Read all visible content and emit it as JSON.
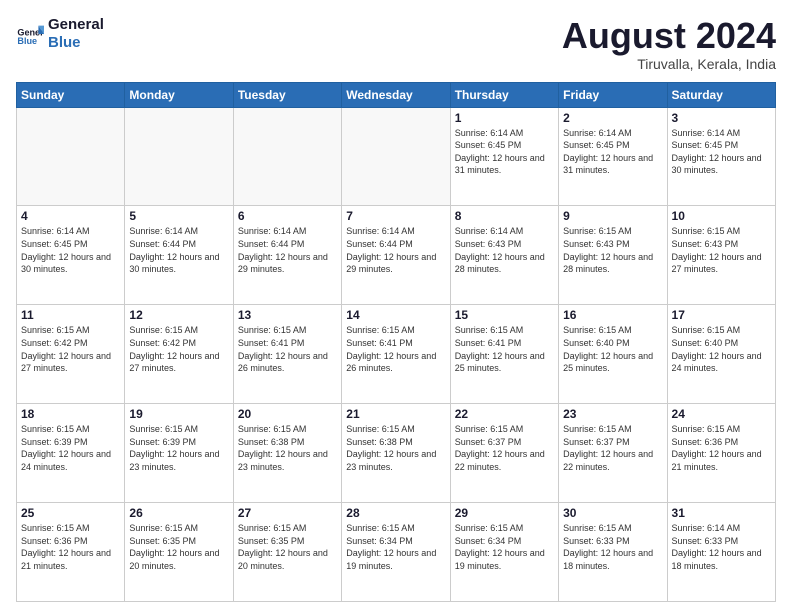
{
  "logo": {
    "line1": "General",
    "line2": "Blue"
  },
  "title": "August 2024",
  "subtitle": "Tiruvalla, Kerala, India",
  "days_header": [
    "Sunday",
    "Monday",
    "Tuesday",
    "Wednesday",
    "Thursday",
    "Friday",
    "Saturday"
  ],
  "weeks": [
    [
      {
        "day": "",
        "info": ""
      },
      {
        "day": "",
        "info": ""
      },
      {
        "day": "",
        "info": ""
      },
      {
        "day": "",
        "info": ""
      },
      {
        "day": "1",
        "info": "Sunrise: 6:14 AM\nSunset: 6:45 PM\nDaylight: 12 hours\nand 31 minutes."
      },
      {
        "day": "2",
        "info": "Sunrise: 6:14 AM\nSunset: 6:45 PM\nDaylight: 12 hours\nand 31 minutes."
      },
      {
        "day": "3",
        "info": "Sunrise: 6:14 AM\nSunset: 6:45 PM\nDaylight: 12 hours\nand 30 minutes."
      }
    ],
    [
      {
        "day": "4",
        "info": "Sunrise: 6:14 AM\nSunset: 6:45 PM\nDaylight: 12 hours\nand 30 minutes."
      },
      {
        "day": "5",
        "info": "Sunrise: 6:14 AM\nSunset: 6:44 PM\nDaylight: 12 hours\nand 30 minutes."
      },
      {
        "day": "6",
        "info": "Sunrise: 6:14 AM\nSunset: 6:44 PM\nDaylight: 12 hours\nand 29 minutes."
      },
      {
        "day": "7",
        "info": "Sunrise: 6:14 AM\nSunset: 6:44 PM\nDaylight: 12 hours\nand 29 minutes."
      },
      {
        "day": "8",
        "info": "Sunrise: 6:14 AM\nSunset: 6:43 PM\nDaylight: 12 hours\nand 28 minutes."
      },
      {
        "day": "9",
        "info": "Sunrise: 6:15 AM\nSunset: 6:43 PM\nDaylight: 12 hours\nand 28 minutes."
      },
      {
        "day": "10",
        "info": "Sunrise: 6:15 AM\nSunset: 6:43 PM\nDaylight: 12 hours\nand 27 minutes."
      }
    ],
    [
      {
        "day": "11",
        "info": "Sunrise: 6:15 AM\nSunset: 6:42 PM\nDaylight: 12 hours\nand 27 minutes."
      },
      {
        "day": "12",
        "info": "Sunrise: 6:15 AM\nSunset: 6:42 PM\nDaylight: 12 hours\nand 27 minutes."
      },
      {
        "day": "13",
        "info": "Sunrise: 6:15 AM\nSunset: 6:41 PM\nDaylight: 12 hours\nand 26 minutes."
      },
      {
        "day": "14",
        "info": "Sunrise: 6:15 AM\nSunset: 6:41 PM\nDaylight: 12 hours\nand 26 minutes."
      },
      {
        "day": "15",
        "info": "Sunrise: 6:15 AM\nSunset: 6:41 PM\nDaylight: 12 hours\nand 25 minutes."
      },
      {
        "day": "16",
        "info": "Sunrise: 6:15 AM\nSunset: 6:40 PM\nDaylight: 12 hours\nand 25 minutes."
      },
      {
        "day": "17",
        "info": "Sunrise: 6:15 AM\nSunset: 6:40 PM\nDaylight: 12 hours\nand 24 minutes."
      }
    ],
    [
      {
        "day": "18",
        "info": "Sunrise: 6:15 AM\nSunset: 6:39 PM\nDaylight: 12 hours\nand 24 minutes."
      },
      {
        "day": "19",
        "info": "Sunrise: 6:15 AM\nSunset: 6:39 PM\nDaylight: 12 hours\nand 23 minutes."
      },
      {
        "day": "20",
        "info": "Sunrise: 6:15 AM\nSunset: 6:38 PM\nDaylight: 12 hours\nand 23 minutes."
      },
      {
        "day": "21",
        "info": "Sunrise: 6:15 AM\nSunset: 6:38 PM\nDaylight: 12 hours\nand 23 minutes."
      },
      {
        "day": "22",
        "info": "Sunrise: 6:15 AM\nSunset: 6:37 PM\nDaylight: 12 hours\nand 22 minutes."
      },
      {
        "day": "23",
        "info": "Sunrise: 6:15 AM\nSunset: 6:37 PM\nDaylight: 12 hours\nand 22 minutes."
      },
      {
        "day": "24",
        "info": "Sunrise: 6:15 AM\nSunset: 6:36 PM\nDaylight: 12 hours\nand 21 minutes."
      }
    ],
    [
      {
        "day": "25",
        "info": "Sunrise: 6:15 AM\nSunset: 6:36 PM\nDaylight: 12 hours\nand 21 minutes."
      },
      {
        "day": "26",
        "info": "Sunrise: 6:15 AM\nSunset: 6:35 PM\nDaylight: 12 hours\nand 20 minutes."
      },
      {
        "day": "27",
        "info": "Sunrise: 6:15 AM\nSunset: 6:35 PM\nDaylight: 12 hours\nand 20 minutes."
      },
      {
        "day": "28",
        "info": "Sunrise: 6:15 AM\nSunset: 6:34 PM\nDaylight: 12 hours\nand 19 minutes."
      },
      {
        "day": "29",
        "info": "Sunrise: 6:15 AM\nSunset: 6:34 PM\nDaylight: 12 hours\nand 19 minutes."
      },
      {
        "day": "30",
        "info": "Sunrise: 6:15 AM\nSunset: 6:33 PM\nDaylight: 12 hours\nand 18 minutes."
      },
      {
        "day": "31",
        "info": "Sunrise: 6:14 AM\nSunset: 6:33 PM\nDaylight: 12 hours\nand 18 minutes."
      }
    ]
  ]
}
